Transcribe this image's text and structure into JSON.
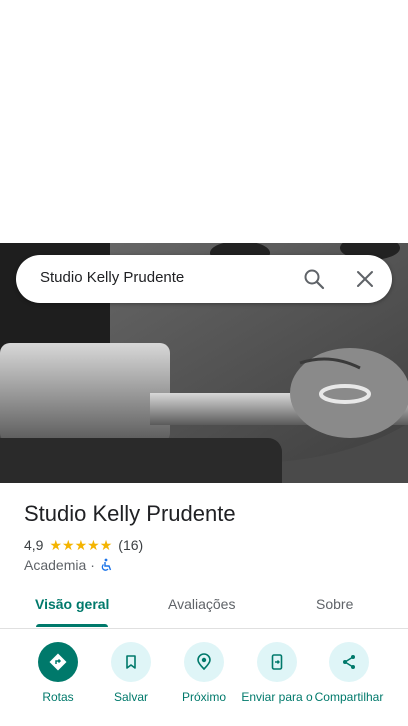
{
  "search": {
    "query": "Studio Kelly Prudente"
  },
  "place": {
    "title": "Studio Kelly Prudente",
    "rating": "4,9",
    "stars": 5,
    "review_count": "(16)",
    "category": "Academia",
    "separator": "·"
  },
  "tabs": [
    {
      "label": "Visão geral",
      "active": true
    },
    {
      "label": "Avaliações",
      "active": false
    },
    {
      "label": "Sobre",
      "active": false
    }
  ],
  "actions": [
    {
      "label": "Rotas",
      "icon": "directions-icon"
    },
    {
      "label": "Salvar",
      "icon": "bookmark-icon"
    },
    {
      "label": "Próximo",
      "icon": "nearby-icon"
    },
    {
      "label": "Enviar para o",
      "icon": "send-to-phone-icon"
    },
    {
      "label": "Compartilhar",
      "icon": "share-icon"
    }
  ],
  "colors": {
    "accent": "#00796b",
    "action_bg": "#dff5f7",
    "star": "#f4b400",
    "accessible": "#1a73e8"
  }
}
